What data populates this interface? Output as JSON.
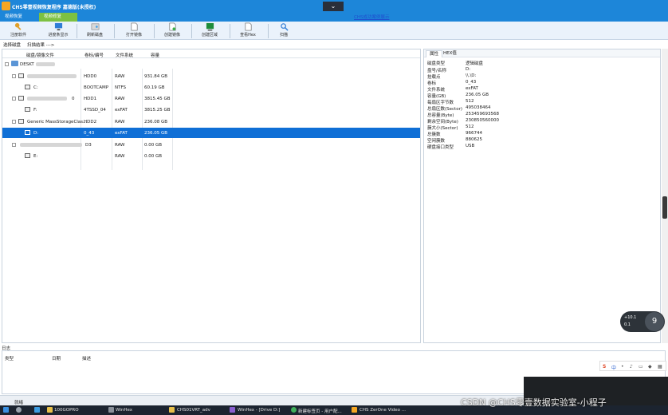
{
  "window": {
    "title": "CHS零壹视频恢复程序 嘉德版(未授权)",
    "link": "CHS成功案例展示",
    "tabs": [
      "视频恢复",
      "视频修复"
    ]
  },
  "toolbar": {
    "buttons": [
      "注册软件",
      "进度条显示",
      "刷新磁盘",
      "打开镜像",
      "创建镜像",
      "创建区域",
      "查看Hex",
      "扫描"
    ]
  },
  "breadcrumb": {
    "select": "选择磁盘",
    "scan": "扫描结果 --->"
  },
  "tree": {
    "headers": [
      "磁盘/镜像文件",
      "卷标/编号",
      "文件系统",
      "容量"
    ],
    "rows": [
      {
        "name": "DESKT",
        "label": "",
        "fs": "",
        "cap": ""
      },
      {
        "name": "",
        "label": "HDD0",
        "fs": "RAW",
        "cap": "931.84 GB"
      },
      {
        "name": "C:",
        "label": "BOOTCAMP",
        "fs": "NTFS",
        "cap": "60.19 GB"
      },
      {
        "name": "0",
        "label": "HDD1",
        "fs": "RAW",
        "cap": "3815.45 GB"
      },
      {
        "name": "F:",
        "label": "4TSSD_04",
        "fs": "exFAT",
        "cap": "3815.25 GB"
      },
      {
        "name": "Generic MassStorageClas...",
        "label": "HDD2",
        "fs": "RAW",
        "cap": "236.08 GB"
      },
      {
        "name": "D:",
        "label": "0_43",
        "fs": "exFAT",
        "cap": "236.05 GB"
      },
      {
        "name": "",
        "label": "D3",
        "fs": "RAW",
        "cap": "0.00 GB"
      },
      {
        "name": "E:",
        "label": "",
        "fs": "RAW",
        "cap": "0.00 GB"
      }
    ]
  },
  "properties": {
    "tabs": [
      "属性",
      "HEX值"
    ],
    "rows": [
      {
        "k": "磁盘类型",
        "v": "逻辑磁盘"
      },
      {
        "k": "盘号/名称",
        "v": "D:"
      },
      {
        "k": "挂载点",
        "v": "\\\\.\\D:"
      },
      {
        "k": "卷标",
        "v": "0_43"
      },
      {
        "k": "文件系统",
        "v": "exFAT"
      },
      {
        "k": "容量(GB)",
        "v": "236.05 GB"
      },
      {
        "k": "每扇区字节数",
        "v": "512"
      },
      {
        "k": "总扇区数(Sector)",
        "v": "495038464"
      },
      {
        "k": "总容量(Byte)",
        "v": "253459693568"
      },
      {
        "k": "剩余空间(Byte)",
        "v": "230850560000"
      },
      {
        "k": "簇大小(Sector)",
        "v": "512"
      },
      {
        "k": "总簇数",
        "v": "966744"
      },
      {
        "k": "空闲簇数",
        "v": "880625"
      },
      {
        "k": "硬盘接口类型",
        "v": "USB"
      }
    ]
  },
  "float_widget": {
    "line1": "+10.1",
    "line2": "0.1",
    "badge": "9"
  },
  "log": {
    "title": "日志",
    "headers": [
      "类型",
      "日期",
      "描述"
    ]
  },
  "status": {
    "text": "就绪"
  },
  "ime": {
    "logo": "S",
    "lang": "中"
  },
  "taskbar": {
    "items": [
      "100GOPRO",
      "WinHex",
      "CHS01VRT_adv",
      "WinHex - [Drive D:]",
      "新建标签页 - 用户配...",
      "CHS ZerOne Video ..."
    ]
  },
  "watermark": "CSDN @CHS零壹数据实验室-小程子",
  "colors": {
    "titlebar": "#1d86d9",
    "active_tab": "#7dc142",
    "selection": "#0f6fd6"
  }
}
